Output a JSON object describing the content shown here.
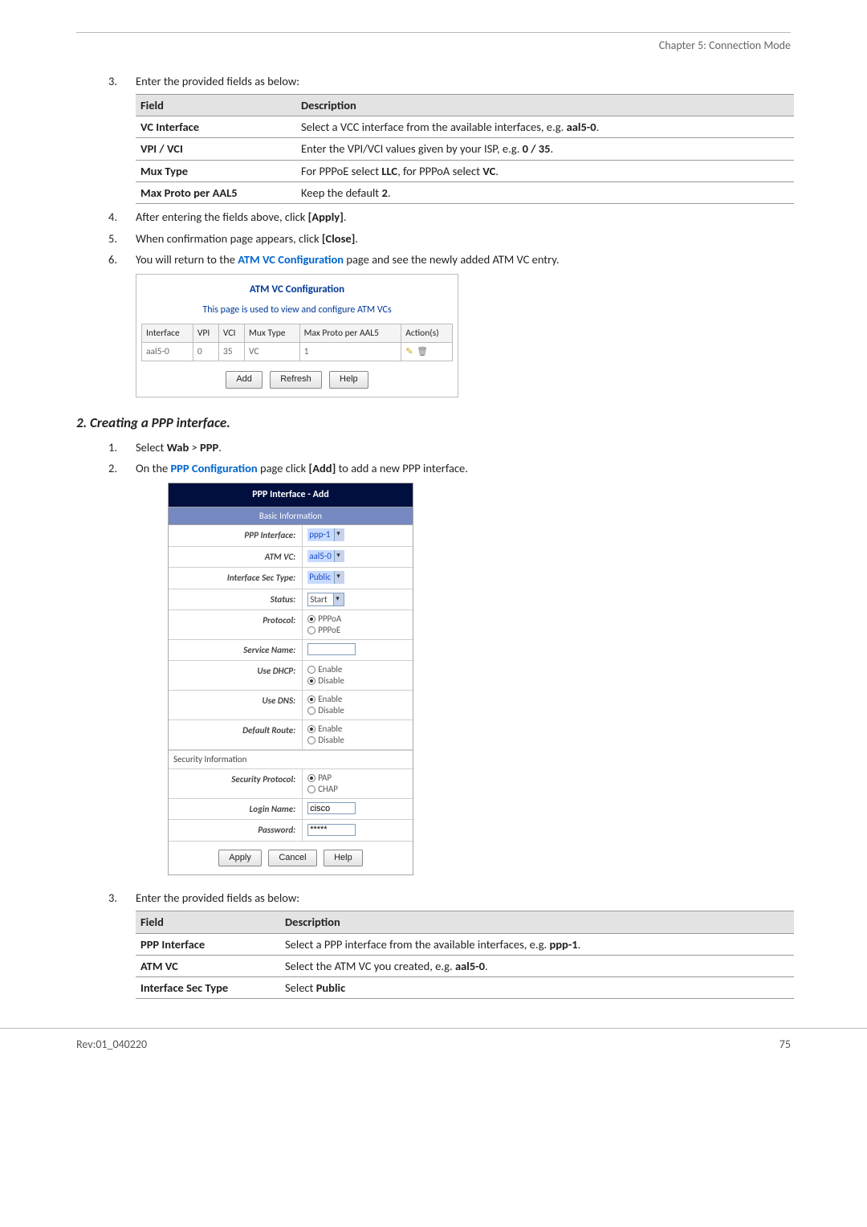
{
  "header": {
    "chapter": "Chapter 5: Connection Mode"
  },
  "footer": {
    "rev": "Rev:01_040220",
    "page": "75"
  },
  "steps_a": [
    {
      "n": "3.",
      "text": "Enter the provided fields as below:"
    }
  ],
  "table1": {
    "head": [
      "Field",
      "Description"
    ],
    "rows": [
      {
        "f": "VC Interface",
        "d_pre": "Select a VCC interface from the available interfaces, e.g. ",
        "d_bold": "aal5-0",
        "d_post": "."
      },
      {
        "f": "VPI / VCI",
        "d_pre": "Enter the VPI/VCI values given by your ISP, e.g. ",
        "d_bold": "0 / 35",
        "d_post": "."
      },
      {
        "f": "Mux Type",
        "d_pre": "For PPPoE select ",
        "d_bold": "LLC",
        "d_mid": ", for PPPoA select ",
        "d_bold2": "VC",
        "d_post": "."
      },
      {
        "f": "Max Proto per AAL5",
        "d_pre": "Keep the default ",
        "d_bold": "2",
        "d_post": "."
      }
    ]
  },
  "steps_b": [
    {
      "n": "4.",
      "pre": "After entering the fields above, click ",
      "bold": "[Apply]",
      "post": "."
    },
    {
      "n": "5.",
      "pre": "When confirmation page appears, click ",
      "bold": "[Close]",
      "post": "."
    },
    {
      "n": "6.",
      "pre": "You will return to the ",
      "link": "ATM VC Configuration",
      "mid": " page and see the newly added ATM VC entry."
    }
  ],
  "atm": {
    "title": "ATM VC Configuration",
    "sub": "This page is used to view and configure ATM VCs",
    "cols": [
      "Interface",
      "VPI",
      "VCI",
      "Mux Type",
      "Max Proto per AAL5",
      "Action(s)"
    ],
    "row": [
      "aal5-0",
      "0",
      "35",
      "VC",
      "1"
    ],
    "buttons": [
      "Add",
      "Refresh",
      "Help"
    ]
  },
  "section2": {
    "title": "2. Creating a PPP interface."
  },
  "steps_c": [
    {
      "n": "1.",
      "pre": "Select ",
      "b1": "Wab",
      "mid": " > ",
      "b2": "PPP",
      "post": "."
    },
    {
      "n": "2.",
      "pre": "On the ",
      "link": "PPP Configuration",
      "mid": " page click ",
      "bold": "[Add]",
      "post": " to add a new PPP interface."
    }
  ],
  "ppp": {
    "title": "PPP Interface - Add",
    "sec1": "Basic Information",
    "rows": [
      {
        "label": "PPP Interface:",
        "type": "select-blue",
        "value": "ppp-1"
      },
      {
        "label": "ATM VC:",
        "type": "select-blue",
        "value": "aal5-0"
      },
      {
        "label": "Interface Sec Type:",
        "type": "select-blue",
        "value": "Public"
      },
      {
        "label": "Status:",
        "type": "select-white",
        "value": "Start"
      },
      {
        "label": "Protocol:",
        "type": "radio2",
        "opts": [
          "PPPoA",
          "PPPoE"
        ],
        "sel": 0
      },
      {
        "label": "Service Name:",
        "type": "text",
        "value": ""
      },
      {
        "label": "Use DHCP:",
        "type": "radio2",
        "opts": [
          "Enable",
          "Disable"
        ],
        "sel": 1
      },
      {
        "label": "Use DNS:",
        "type": "radio2",
        "opts": [
          "Enable",
          "Disable"
        ],
        "sel": 0
      },
      {
        "label": "Default Route:",
        "type": "radio2",
        "opts": [
          "Enable",
          "Disable"
        ],
        "sel": 0
      }
    ],
    "sec2": "Security Information",
    "rows2": [
      {
        "label": "Security Protocol:",
        "type": "radio2",
        "opts": [
          "PAP",
          "CHAP"
        ],
        "sel": 0
      },
      {
        "label": "Login Name:",
        "type": "text",
        "value": "cisco"
      },
      {
        "label": "Password:",
        "type": "text",
        "value": "*****"
      }
    ],
    "buttons": [
      "Apply",
      "Cancel",
      "Help"
    ]
  },
  "steps_d": [
    {
      "n": "3.",
      "text": "Enter the provided fields as below:"
    }
  ],
  "table2": {
    "head": [
      "Field",
      "Description"
    ],
    "rows": [
      {
        "f": "PPP Interface",
        "d_pre": "Select a PPP interface from the available interfaces, e.g. ",
        "d_bold": "ppp-1",
        "d_post": "."
      },
      {
        "f": "ATM VC",
        "d_pre": "Select the ATM VC you created, e.g. ",
        "d_bold": "aal5-0",
        "d_post": "."
      },
      {
        "f": "Interface Sec Type",
        "d_pre": "Select ",
        "d_bold": "Public",
        "d_post": ""
      }
    ]
  }
}
